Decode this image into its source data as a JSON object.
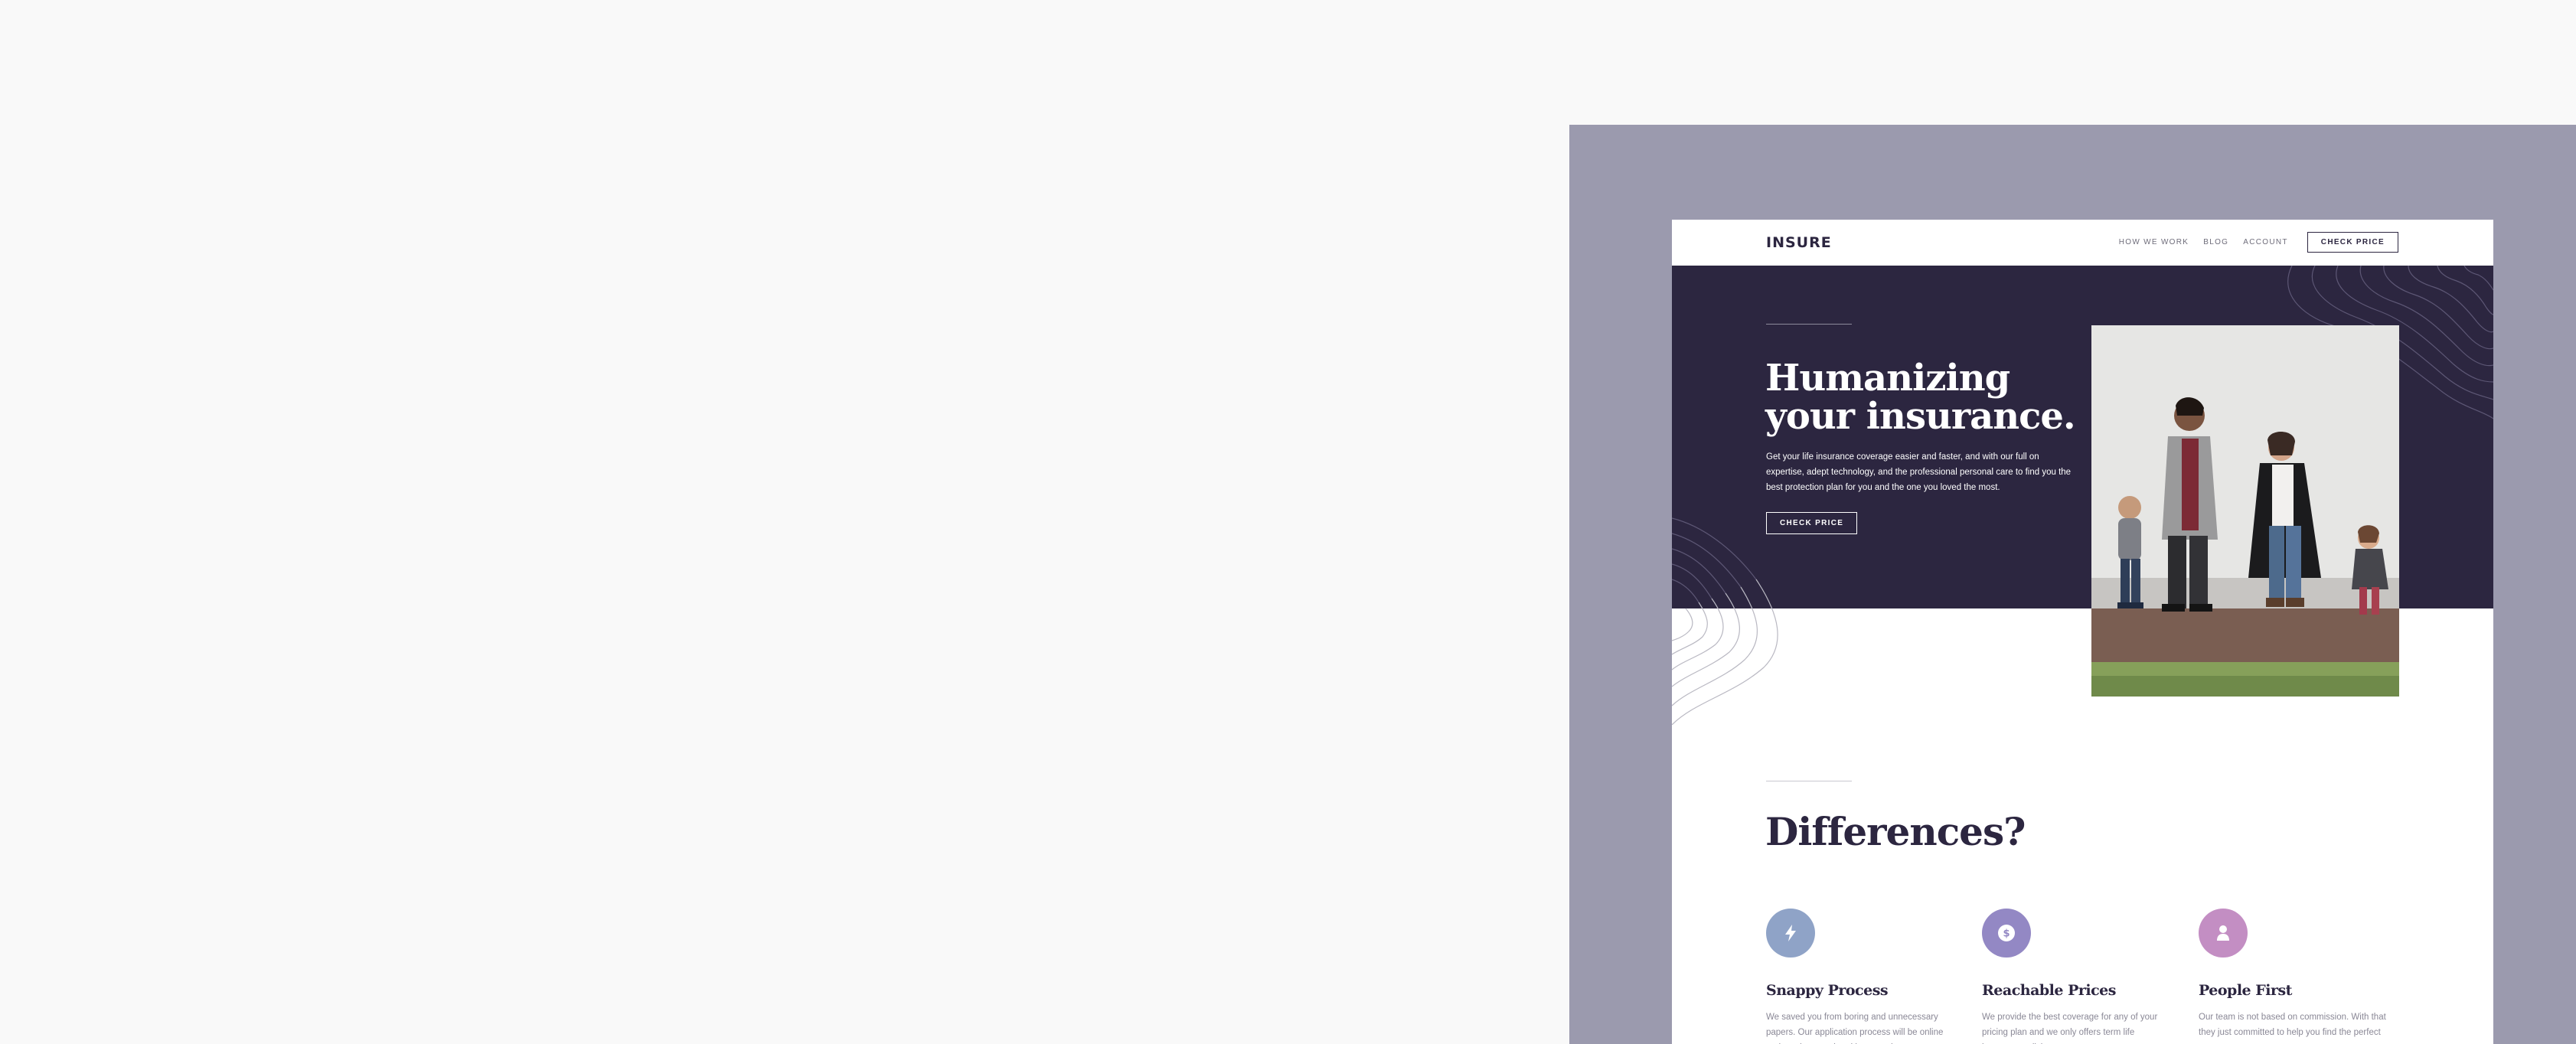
{
  "header": {
    "logo": "INSURE",
    "nav": [
      "HOW WE WORK",
      "BLOG",
      "ACCOUNT"
    ],
    "cta": "CHECK PRICE"
  },
  "hero": {
    "title": "Humanizing your insurance.",
    "text": "Get your life insurance coverage easier and faster, and with our full on expertise, adept technology, and the professional personal care to find you the best protection plan for you and the one you loved the most.",
    "cta": "CHECK PRICE"
  },
  "differences": {
    "title": "Differences?",
    "features": [
      {
        "icon": "lightning-icon",
        "color": "#8fa3c7",
        "title": "Snappy Process",
        "text": "We saved you from boring and unnecessary papers. Our application process will be online and can be completed in seconds."
      },
      {
        "icon": "dollar-icon",
        "color": "#9388c4",
        "title": "Reachable Prices",
        "text": "We provide the best coverage for any of your pricing plan and we only offers term life insurance policies."
      },
      {
        "icon": "person-icon",
        "color": "#c38ec3",
        "title": "People First",
        "text": "Our team is not based on commission. With that they just committed to help you find the perfect coverage."
      }
    ]
  },
  "colors": {
    "page_bg": "#f9f9f9",
    "stage_bg": "#9b9aae",
    "hero_bg": "#2c2640",
    "text_dark": "#2c2640"
  }
}
